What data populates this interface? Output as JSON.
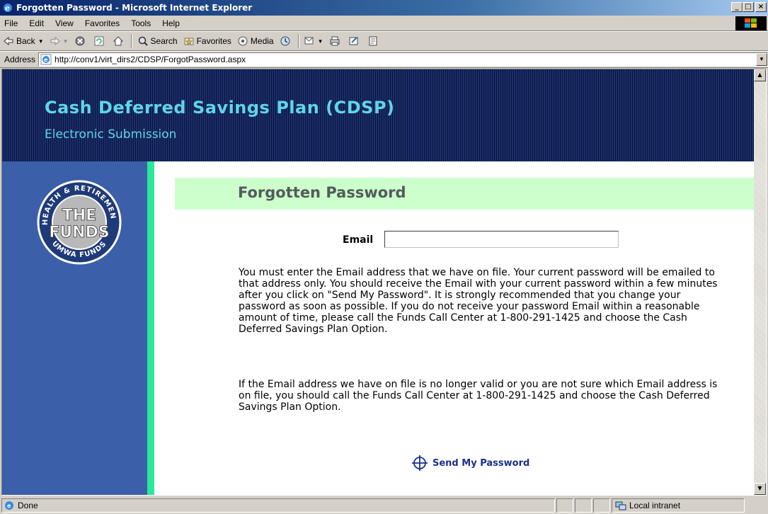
{
  "window": {
    "title": "Forgotten Password - Microsoft Internet Explorer",
    "controls": {
      "minimize": "_",
      "maximize": "□",
      "close": "×"
    }
  },
  "menu": [
    "File",
    "Edit",
    "View",
    "Favorites",
    "Tools",
    "Help"
  ],
  "toolbar": {
    "back": "Back",
    "search": "Search",
    "favorites": "Favorites",
    "media": "Media"
  },
  "address": {
    "label": "Address",
    "url": "http://conv1/virt_dirs2/CDSP/ForgotPassword.aspx"
  },
  "page": {
    "header_title": "Cash Deferred Savings Plan (CDSP)",
    "header_subtitle": "Electronic Submission",
    "logo": {
      "ring_top": "HEALTH & RETIREMENT",
      "ring_bottom": "UMWA FUNDS",
      "center_top": "THE",
      "center_bottom": "FUNDS"
    },
    "form_title": "Forgotten Password",
    "email_label": "Email",
    "email_value": "",
    "paragraph1": "You must enter the Email address that we have on file. Your current password will be emailed to that address only. You should receive the Email with your current password within a few minutes after you click on \"Send My Password\". It is strongly recommended that you change your password as soon as possible. If you do not receive your password Email within a reasonable amount of time, please call the Funds Call Center at 1-800-291-1425 and choose the Cash Deferred Savings Plan Option.",
    "paragraph2": "If the Email address we have on file is no longer valid or you are not sure which Email address is on file, you should call the Funds Call Center at 1-800-291-1425 and choose the Cash Deferred Savings Plan Option.",
    "send_button": "Send My Password"
  },
  "status": {
    "text": "Done",
    "zone": "Local intranet"
  }
}
